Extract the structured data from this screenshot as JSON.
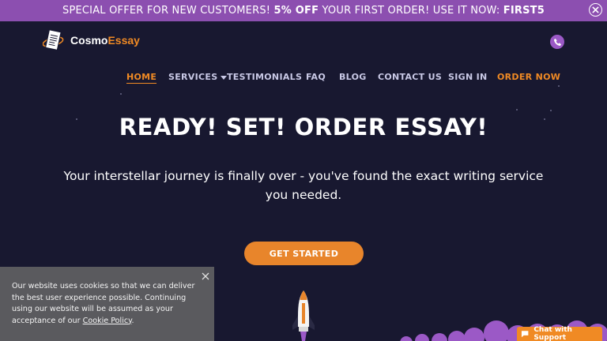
{
  "promo": {
    "text_before": "SPECIAL OFFER FOR NEW CUSTOMERS!",
    "discount": "5% OFF",
    "text_middle": "YOUR FIRST ORDER! USE IT NOW:",
    "code": "FIRST5",
    "close_icon": "close-icon"
  },
  "header": {
    "logo_part1": "Cosmo",
    "logo_part2": "Essay",
    "phone_icon": "phone-icon"
  },
  "nav": {
    "home": "HOME",
    "services": "SERVICES",
    "testimonials": "TESTIMONIALS",
    "faq": "FAQ",
    "blog": "BLOG",
    "contact": "CONTACT US",
    "signin": "SIGN IN",
    "order": "ORDER NOW"
  },
  "hero": {
    "title": "READY! SET! ORDER ESSAY!",
    "subtitle": "Your interstellar journey is finally over - you've found the exact writing service you needed.",
    "cta": "GET STARTED"
  },
  "cookie": {
    "text": "Our website uses cookies so that we can deliver the best user experience possible. Continuing using our website will be assumed as your acceptance of our",
    "link": "Cookie Policy",
    "end": "."
  },
  "chat": {
    "label": "Chat with Support",
    "icon": "chat-bubble-icon"
  },
  "colors": {
    "background": "#181830",
    "promo": "#8c4fb0",
    "accent": "#f08a24",
    "cookie_bg": "#5a5a5e"
  }
}
